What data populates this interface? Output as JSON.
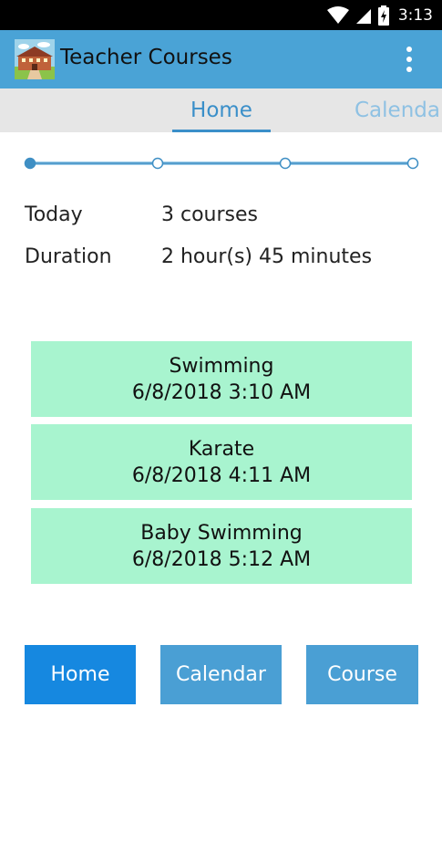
{
  "status_bar": {
    "time": "3:13"
  },
  "app_bar": {
    "title": "Teacher Courses"
  },
  "tabs": [
    {
      "label": "Home",
      "active": true
    },
    {
      "label": "Calendar",
      "active": false
    }
  ],
  "stepper": {
    "steps": 4,
    "current": 1
  },
  "summary": {
    "today_label": "Today",
    "today_value": "3 courses",
    "duration_label": "Duration",
    "duration_value": "2 hour(s) 45 minutes"
  },
  "courses": [
    {
      "name": "Swimming",
      "datetime": "6/8/2018 3:10 AM"
    },
    {
      "name": "Karate",
      "datetime": "6/8/2018 4:11 AM"
    },
    {
      "name": "Baby Swimming",
      "datetime": "6/8/2018 5:12 AM"
    }
  ],
  "bottom_nav": [
    {
      "label": "Home",
      "active": true
    },
    {
      "label": "Calendar",
      "active": false
    },
    {
      "label": "Course",
      "active": false
    }
  ],
  "colors": {
    "app_bar": "#4aa3d6",
    "tab_active": "#3a8fc9",
    "card": "#a8f4cf",
    "button_active": "#1688e0",
    "button_inactive": "#4a9fd4"
  }
}
